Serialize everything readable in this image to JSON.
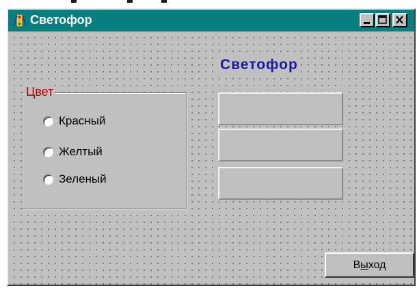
{
  "window": {
    "title": "Светофор"
  },
  "main": {
    "heading": "Светофор",
    "color_group": {
      "legend": "Цвет",
      "options": [
        {
          "label": "Красный",
          "selected": false
        },
        {
          "label": "Желтый",
          "selected": false
        },
        {
          "label": "Зеленый",
          "selected": false
        }
      ]
    },
    "lights": [
      {
        "name": "red-light-panel",
        "lit": false
      },
      {
        "name": "yellow-light-panel",
        "lit": false
      },
      {
        "name": "green-light-panel",
        "lit": false
      }
    ],
    "exit_button": {
      "label_before": "В",
      "label_underlined": "ы",
      "label_after": "ход"
    }
  },
  "colors": {
    "titlebar": "#077f7e",
    "heading": "#1a1aa8",
    "legend": "#b00000",
    "face": "#c0c0c0"
  },
  "icons": {
    "app": "traffic-light-icon",
    "minimize": "minimize-icon",
    "maximize": "maximize-icon",
    "close": "close-icon"
  }
}
